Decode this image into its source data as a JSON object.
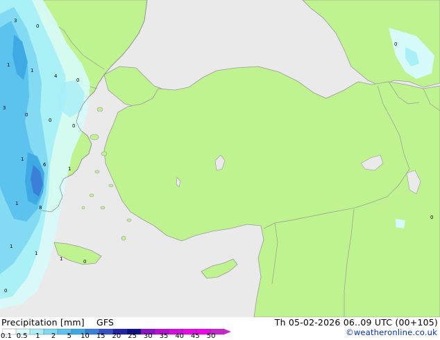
{
  "title": "Precipitation [mm]",
  "model": "GFS",
  "valid_time": "Th 05-02-2026 06..09 UTC (00+105)",
  "credit": "©weatheronline.co.uk",
  "colors": {
    "sea": "#eaeaea",
    "land": "#bff38f",
    "border": "#9a9a9a",
    "credit": "#002fbe"
  },
  "legend": {
    "ticks": [
      "0.1",
      "0.5",
      "1",
      "2",
      "5",
      "10",
      "15",
      "20",
      "25",
      "30",
      "35",
      "40",
      "45",
      "50"
    ],
    "colors": [
      "#ffffff",
      "#d7fbfb",
      "#a8eff7",
      "#7fd8f2",
      "#5cc2ee",
      "#3fa9e4",
      "#3b80d8",
      "#3452c6",
      "#2223a6",
      "#0e0f86",
      "#8a14c8",
      "#b80fd0",
      "#d60ddf",
      "#e40be4",
      "#ef08ea",
      "#c428c8"
    ]
  },
  "map_labels": [
    "3",
    "0",
    "1",
    "1",
    "4",
    "0",
    "0",
    "3",
    "0",
    "0",
    "0",
    "1",
    "6",
    "1",
    "1",
    "8",
    "1",
    "1",
    "1",
    "0",
    "0",
    "0"
  ]
}
